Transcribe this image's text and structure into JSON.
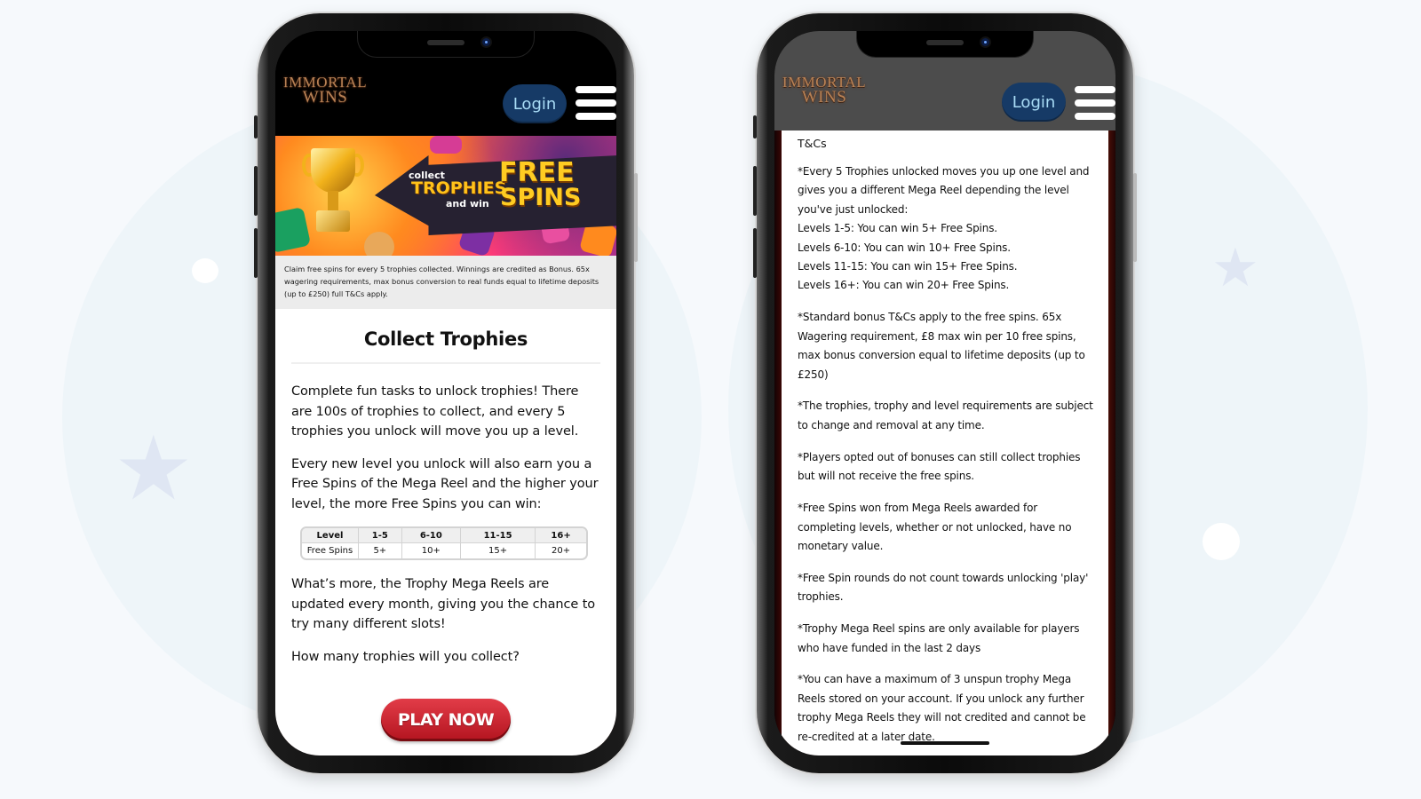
{
  "background": {
    "color": "#f6f9fc",
    "decorations": [
      "circle",
      "circle",
      "star",
      "star",
      "dot",
      "dot"
    ]
  },
  "phones": [
    {
      "id": "left",
      "header": {
        "logo_line1": "IMMORTAL",
        "logo_line2": "WINS",
        "login_label": "Login",
        "menu_icon": "hamburger-icon",
        "background": "#000000"
      },
      "banner": {
        "collect": "collect",
        "trophies": "TROPHIES",
        "and_win": "and win",
        "free": "FREE",
        "spins": "SPINS"
      },
      "disclaimer": "Claim free spins for every 5 trophies collected. Winnings are credited as Bonus. 65x wagering requirements, max bonus conversion to real funds equal to lifetime deposits (up to £250) full T&Cs apply.",
      "title": "Collect Trophies",
      "paragraphs": [
        "Complete fun tasks to unlock trophies! There are 100s of trophies to collect, and every 5 trophies you unlock will move you up a level.",
        "Every new level you unlock will also earn you a Free Spins of the Mega Reel and the higher your level, the more Free Spins you can win:"
      ],
      "table": {
        "header": [
          "Level",
          "1-5",
          "6-10",
          "11-15",
          "16+"
        ],
        "row": [
          "Free Spins",
          "5+",
          "10+",
          "15+",
          "20+"
        ]
      },
      "paragraphs_after": [
        "What’s more, the Trophy Mega Reels are updated every month, giving you the chance to try many different slots!",
        "How many trophies will you collect?"
      ],
      "cta_label": "PLAY NOW",
      "cta_color": "#c8202c"
    },
    {
      "id": "right",
      "header": {
        "logo_line1": "IMMORTAL",
        "logo_line2": "WINS",
        "login_label": "Login",
        "menu_icon": "hamburger-icon",
        "background": "#4c4c4c"
      },
      "tcs_title": "T&Cs",
      "tcs_paragraphs": [
        "*Every 5 Trophies unlocked moves you up one level and gives you a different Mega Reel depending the level you've just unlocked:",
        "*Standard bonus T&Cs apply to the free spins. 65x Wagering requirement, £8 max win per 10 free spins, max bonus conversion equal to lifetime deposits (up to £250)",
        "*The trophies, trophy and level requirements are subject to change and removal at any time.",
        "*Players opted out of bonuses can still collect trophies but will not receive the free spins.",
        "*Free Spins won from Mega Reels awarded for completing levels, whether or not unlocked, have no monetary value.",
        "*Free Spin rounds do not count towards unlocking 'play' trophies.",
        "*Trophy Mega Reel spins are only available for players who have funded in the last 2 days",
        "*You can have a maximum of 3 unspun trophy Mega Reels stored on your account. If you unlock any further trophy Mega Reels they will not credited and cannot be re-credited at a later date."
      ],
      "level_lines": [
        "Levels 1-5: You can win 5+ Free Spins.",
        "Levels 6-10: You can win 10+ Free Spins.",
        "Levels 11-15: You can win 15+ Free Spins.",
        "Levels 16+: You can win 20+ Free Spins."
      ]
    }
  ]
}
